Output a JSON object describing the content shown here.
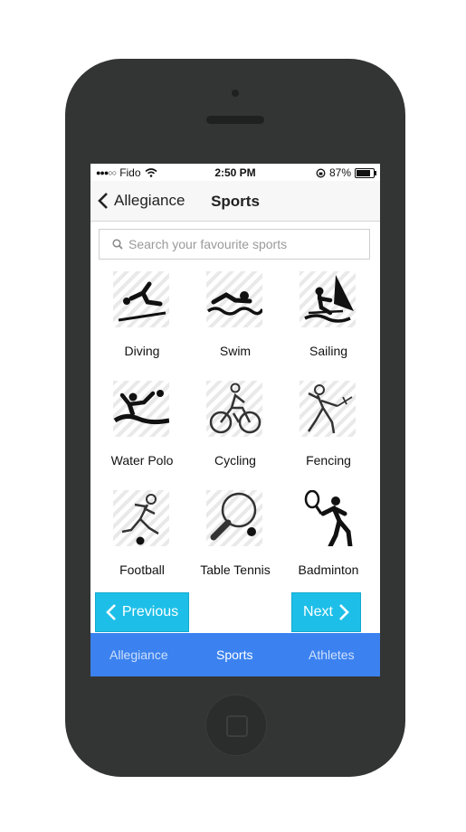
{
  "status": {
    "carrier": "Fido",
    "signal": "●●●○○",
    "time": "2:50 PM",
    "battery": "87%"
  },
  "nav": {
    "back_label": "Allegiance",
    "title": "Sports"
  },
  "search": {
    "placeholder": "Search your favourite sports"
  },
  "sports": [
    {
      "label": "Diving",
      "icon": "diving-icon"
    },
    {
      "label": "Swim",
      "icon": "swim-icon"
    },
    {
      "label": "Sailing",
      "icon": "sailing-icon"
    },
    {
      "label": "Water Polo",
      "icon": "water-polo-icon"
    },
    {
      "label": "Cycling",
      "icon": "cycling-icon"
    },
    {
      "label": "Fencing",
      "icon": "fencing-icon"
    },
    {
      "label": "Football",
      "icon": "football-icon"
    },
    {
      "label": "Table Tennis",
      "icon": "table-tennis-icon"
    },
    {
      "label": "Badminton",
      "icon": "badminton-icon"
    }
  ],
  "buttons": {
    "previous": "Previous",
    "next": "Next"
  },
  "tabs": [
    {
      "label": "Allegiance",
      "active": false
    },
    {
      "label": "Sports",
      "active": true
    },
    {
      "label": "Athletes",
      "active": false
    }
  ],
  "colors": {
    "accent_button": "#1dbfe8",
    "tabbar": "#3b82f0",
    "device": "#333535"
  }
}
